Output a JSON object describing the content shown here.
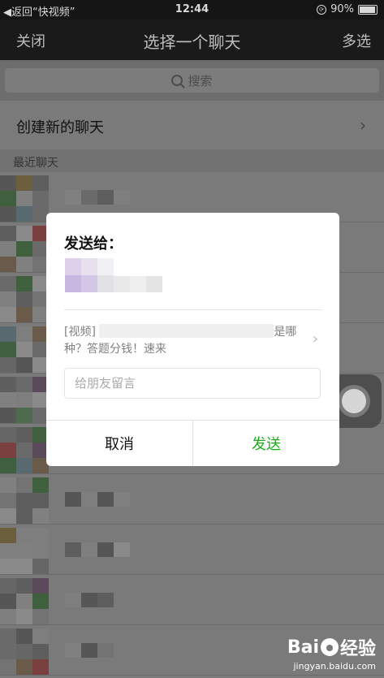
{
  "status_bar": {
    "back": "◀返回“快视频”",
    "time": "12:44",
    "battery": "90%"
  },
  "nav": {
    "close": "关闭",
    "title": "选择一个聊天",
    "multi_select": "多选"
  },
  "search": {
    "placeholder": "搜索",
    "icon": "search-icon"
  },
  "create_chat": {
    "label": "创建新的聊天",
    "chevron": "›"
  },
  "recent": {
    "header": "最近聊天"
  },
  "dialog": {
    "title": "发送给：",
    "video_prefix": "[视频]",
    "video_suffix": "是哪种？答题分钱！速来",
    "chevron": "›",
    "message_placeholder": "给朋友留言",
    "cancel": "取消",
    "send": "发送"
  },
  "colors": {
    "send_green": "#1aad19",
    "nav_bg": "#1a1a1a",
    "overlay_bg": "#7a7a7a",
    "dialog_bg": "#ffffff"
  },
  "watermark": {
    "logo": "Bai",
    "logo_tail": "经验",
    "url": "jingyan.baidu.com"
  }
}
